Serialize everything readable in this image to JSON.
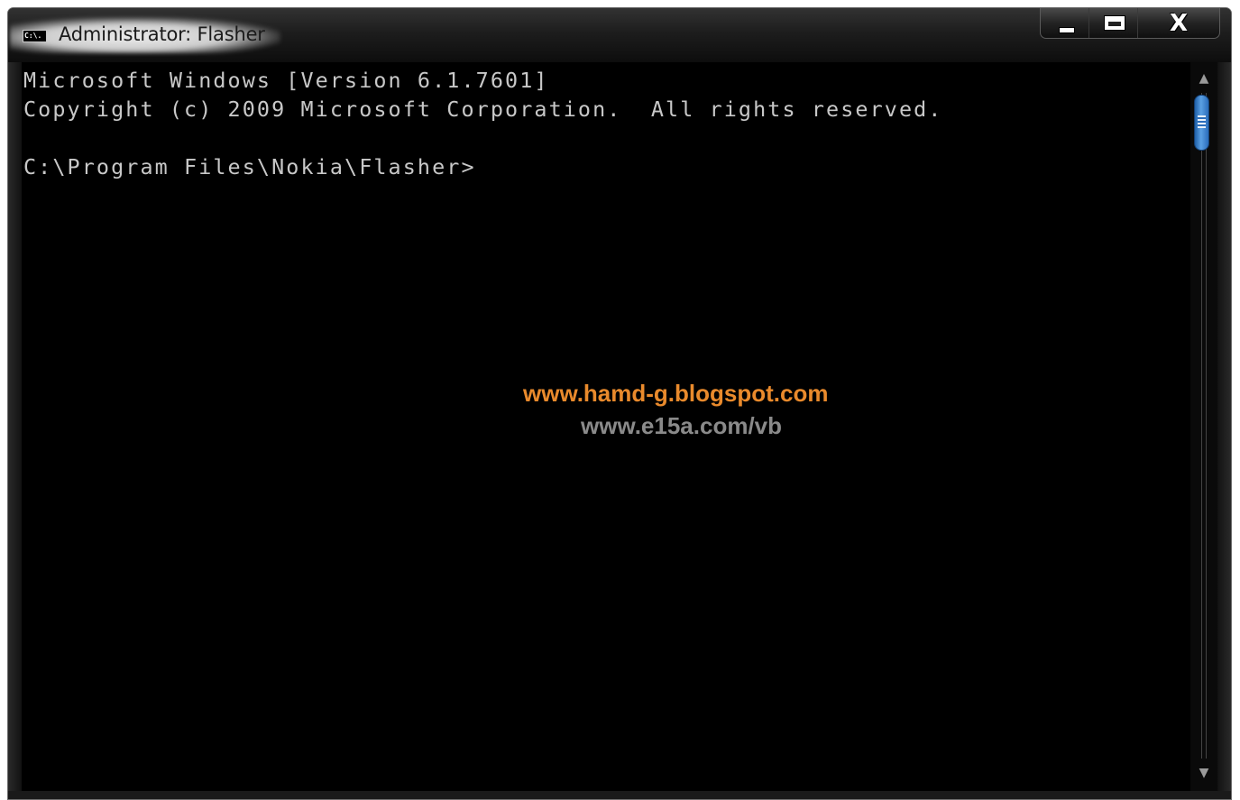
{
  "window": {
    "title": "Administrator: Flasher",
    "icon": "cmd-icon",
    "icon_text": "C:\\."
  },
  "caption_buttons": {
    "minimize": "minimize-icon",
    "maximize": "maximize-icon",
    "close": "X"
  },
  "console": {
    "lines": [
      "Microsoft Windows [Version 6.1.7601]",
      "Copyright (c) 2009 Microsoft Corporation.  All rights reserved.",
      "",
      "C:\\Program Files\\Nokia\\Flasher>"
    ],
    "text_color": "#c8c8c8",
    "background_color": "#000000"
  },
  "watermark": {
    "line1": "www.hamd-g.blogspot.com",
    "line2": "www.e15a.com/vb",
    "line1_color": "#e98a2c",
    "line2_color": "#8a8a8a"
  },
  "scrollbar": {
    "up_arrow": "▲",
    "down_arrow": "▼",
    "thumb_color": "#3a86d4"
  }
}
